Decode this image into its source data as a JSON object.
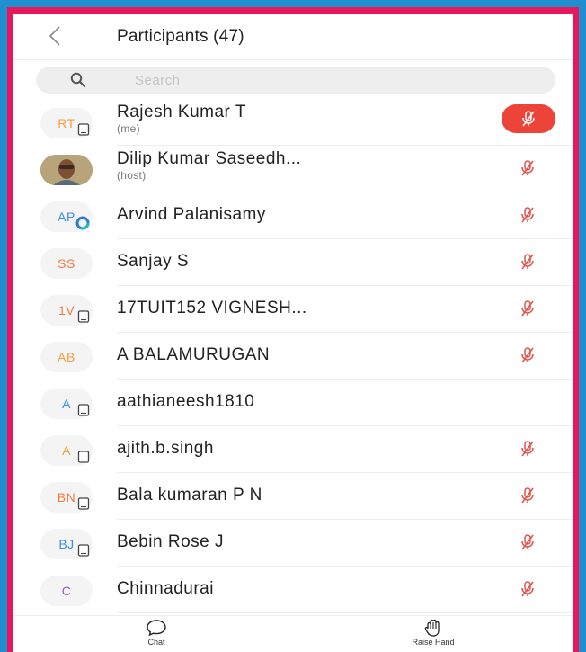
{
  "header": {
    "title": "Participants (47)"
  },
  "search": {
    "placeholder": "Search"
  },
  "participants": [
    {
      "initials": "RT",
      "color": "#f0a040",
      "name": "Rajesh Kumar T",
      "sub": "(me)",
      "badge": "device",
      "mic": "active"
    },
    {
      "initials": "",
      "color": "#c9b48a",
      "name": "Dilip Kumar Saseedh...",
      "sub": "(host)",
      "badge": "photo",
      "mic": "muted"
    },
    {
      "initials": "AP",
      "color": "#3a8ee0",
      "name": "Arvind Palanisamy",
      "sub": "",
      "badge": "ring",
      "mic": "muted"
    },
    {
      "initials": "SS",
      "color": "#f07b3f",
      "name": " Sanjay S",
      "sub": "",
      "badge": "none",
      "mic": "muted"
    },
    {
      "initials": "1V",
      "color": "#f07b3f",
      "name": "17TUIT152 VIGNESH...",
      "sub": "",
      "badge": "device",
      "mic": "muted"
    },
    {
      "initials": "AB",
      "color": "#f0a040",
      "name": "A BALAMURUGAN",
      "sub": "",
      "badge": "none",
      "mic": "muted"
    },
    {
      "initials": "A",
      "color": "#3a8ee0",
      "name": "aathianeesh1810",
      "sub": "",
      "badge": "device",
      "mic": "none"
    },
    {
      "initials": "A",
      "color": "#f0a040",
      "name": "ajith.b.singh",
      "sub": "",
      "badge": "device",
      "mic": "muted"
    },
    {
      "initials": "BN",
      "color": "#f07b3f",
      "name": "Bala kumaran P N",
      "sub": "",
      "badge": "device",
      "mic": "muted"
    },
    {
      "initials": "BJ",
      "color": "#3a8ee0",
      "name": "Bebin Rose J",
      "sub": "",
      "badge": "device",
      "mic": "muted"
    },
    {
      "initials": "C",
      "color": "#9b59b6",
      "name": "Chinnadurai",
      "sub": "",
      "badge": "none",
      "mic": "muted"
    }
  ],
  "footer": {
    "chat_label": "Chat",
    "raise_hand_label": "Raise Hand"
  },
  "colors": {
    "frame": "#e8175d",
    "background": "#1f8fd0",
    "mic_muted": "#e0524a",
    "mic_active_bg": "#ec4438"
  },
  "icons": {
    "back": "chevron-left-icon",
    "search": "search-icon",
    "mic": "mic-off-icon",
    "chat": "chat-bubble-icon",
    "raise_hand": "hand-icon"
  }
}
